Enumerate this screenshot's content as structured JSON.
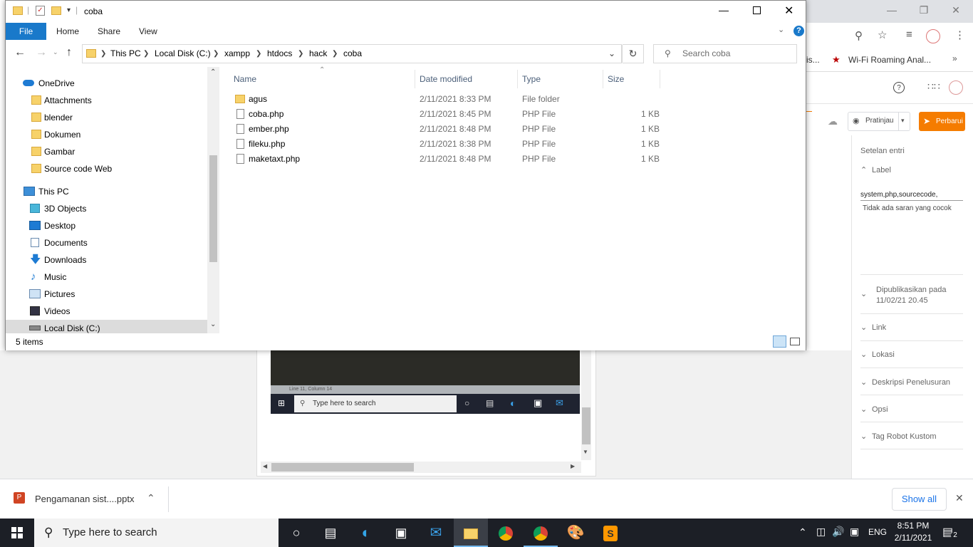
{
  "browser": {
    "bookmark_label": "Wi-Fi Roaming Anal...",
    "bookmark_partial": "is..."
  },
  "blogger": {
    "preview_label": "Pratinjau",
    "update_label": "Perbarui",
    "settings_heading": "Setelan entri",
    "label_section": "Label",
    "label_value": "system,php,sourcecode,",
    "label_suggest": "Tidak ada saran yang cocok",
    "published_title": "Dipublikasikan pada",
    "published_value": "11/02/21 20.45",
    "link_section": "Link",
    "location_section": "Lokasi",
    "search_desc_section": "Deskripsi Penelusuran",
    "options_section": "Opsi",
    "robot_tags_section": "Tag Robot Kustom",
    "embedded_status": "Line 11, Column 14",
    "embedded_search": "Type here to search"
  },
  "explorer": {
    "title": "coba",
    "tabs": {
      "file": "File",
      "home": "Home",
      "share": "Share",
      "view": "View"
    },
    "breadcrumb": [
      "This PC",
      "Local Disk (C:)",
      "xampp",
      "htdocs",
      "hack",
      "coba"
    ],
    "search_placeholder": "Search coba",
    "nav": {
      "onedrive": "OneDrive",
      "attachments": "Attachments",
      "blender": "blender",
      "dokumen": "Dokumen",
      "gambar": "Gambar",
      "source_code_web": "Source code Web",
      "this_pc": "This PC",
      "objects3d": "3D Objects",
      "desktop": "Desktop",
      "documents": "Documents",
      "downloads": "Downloads",
      "music": "Music",
      "pictures": "Pictures",
      "videos": "Videos",
      "local_disk": "Local Disk (C:)"
    },
    "columns": {
      "name": "Name",
      "date": "Date modified",
      "type": "Type",
      "size": "Size"
    },
    "files": [
      {
        "name": "agus",
        "date": "2/11/2021 8:33 PM",
        "type": "File folder",
        "size": ""
      },
      {
        "name": "coba.php",
        "date": "2/11/2021 8:45 PM",
        "type": "PHP File",
        "size": "1 KB"
      },
      {
        "name": "ember.php",
        "date": "2/11/2021 8:48 PM",
        "type": "PHP File",
        "size": "1 KB"
      },
      {
        "name": "fileku.php",
        "date": "2/11/2021 8:38 PM",
        "type": "PHP File",
        "size": "1 KB"
      },
      {
        "name": "maketaxt.php",
        "date": "2/11/2021 8:48 PM",
        "type": "PHP File",
        "size": "1 KB"
      }
    ],
    "status": "5 items"
  },
  "downloads": {
    "file_name": "Pengamanan sist....pptx",
    "show_all": "Show all"
  },
  "taskbar": {
    "search_placeholder": "Type here to search",
    "language": "ENG",
    "time": "8:51 PM",
    "date": "2/11/2021",
    "notification_count": "2"
  },
  "colors": {
    "accent_blue": "#1979ca",
    "blogger_orange": "#f57c00",
    "taskbar": "#1c1f26"
  }
}
